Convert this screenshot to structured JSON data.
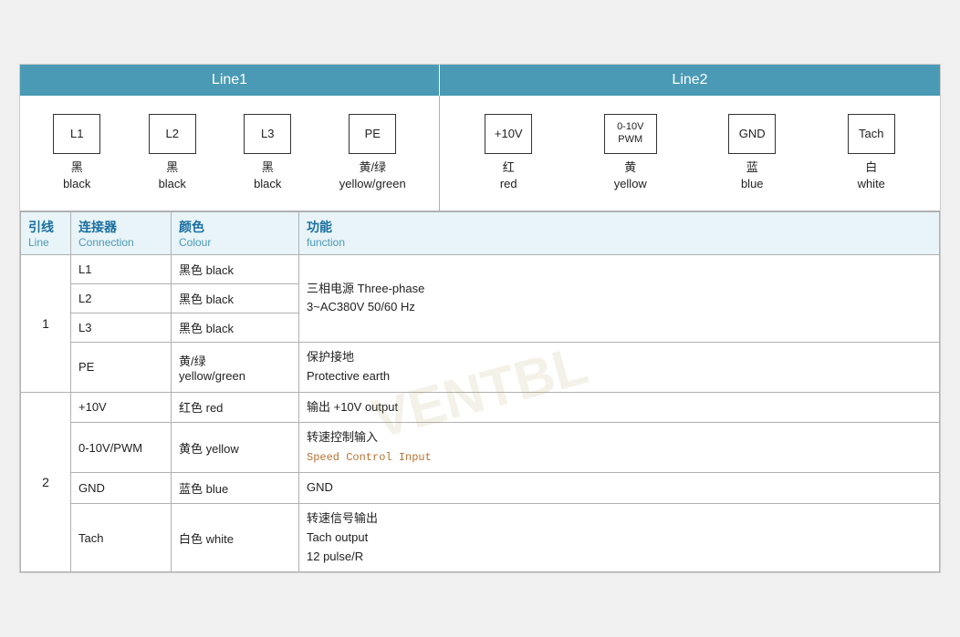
{
  "header": {
    "line1_label": "Line1",
    "line2_label": "Line2"
  },
  "line1_connectors": [
    {
      "box_label": "L1",
      "chinese": "黑",
      "english": "black"
    },
    {
      "box_label": "L2",
      "chinese": "黑",
      "english": "black"
    },
    {
      "box_label": "L3",
      "chinese": "黑",
      "english": "black"
    },
    {
      "box_label": "PE",
      "chinese": "黄/绿",
      "english": "yellow/green"
    }
  ],
  "line2_connectors": [
    {
      "box_label": "+10V",
      "chinese": "红",
      "english": "red"
    },
    {
      "box_label": "0-10V\nPWM",
      "chinese": "黄",
      "english": "yellow"
    },
    {
      "box_label": "GND",
      "chinese": "蓝",
      "english": "blue"
    },
    {
      "box_label": "Tach",
      "chinese": "白",
      "english": "white"
    }
  ],
  "table_headers": {
    "line_zh": "引线",
    "line_en": "Line",
    "connection_zh": "连接器",
    "connection_en": "Connection",
    "colour_zh": "颜色",
    "colour_en": "Colour",
    "function_zh": "功能",
    "function_en": "function"
  },
  "table_rows": [
    {
      "line_number": "1",
      "line_rowspan": 4,
      "entries": [
        {
          "connection": "L1",
          "colour": "黑色 black",
          "function": "三相电源 Three-phase\n3~AC380V 50/60 Hz",
          "function_rowspan": 3
        },
        {
          "connection": "L2",
          "colour": "黑色 black",
          "skip_function": true
        },
        {
          "connection": "L3",
          "colour": "黑色 black",
          "skip_function": true
        },
        {
          "connection": "PE",
          "colour_line1": "黄/绿",
          "colour_line2": "yellow/green",
          "function": "保护接地\nProtective earth",
          "function_rowspan": 1
        }
      ]
    },
    {
      "line_number": "2",
      "line_rowspan": 4,
      "entries": [
        {
          "connection": "+10V",
          "colour": "红色 red",
          "function": "输出 +10V output",
          "function_rowspan": 1
        },
        {
          "connection": "0-10V/PWM",
          "colour": "黄色 yellow",
          "function_line1": "转速控制输入",
          "function_line2": "Speed Control Input",
          "function_monospace": true,
          "function_rowspan": 1
        },
        {
          "connection": "GND",
          "colour": "蓝色 blue",
          "function": "GND",
          "function_rowspan": 1
        },
        {
          "connection": "Tach",
          "colour": "白色 white",
          "function_lines": [
            "转速信号输出",
            "Tach output",
            "12 pulse/R"
          ],
          "function_rowspan": 1
        }
      ]
    }
  ],
  "watermark": "VENTBL"
}
